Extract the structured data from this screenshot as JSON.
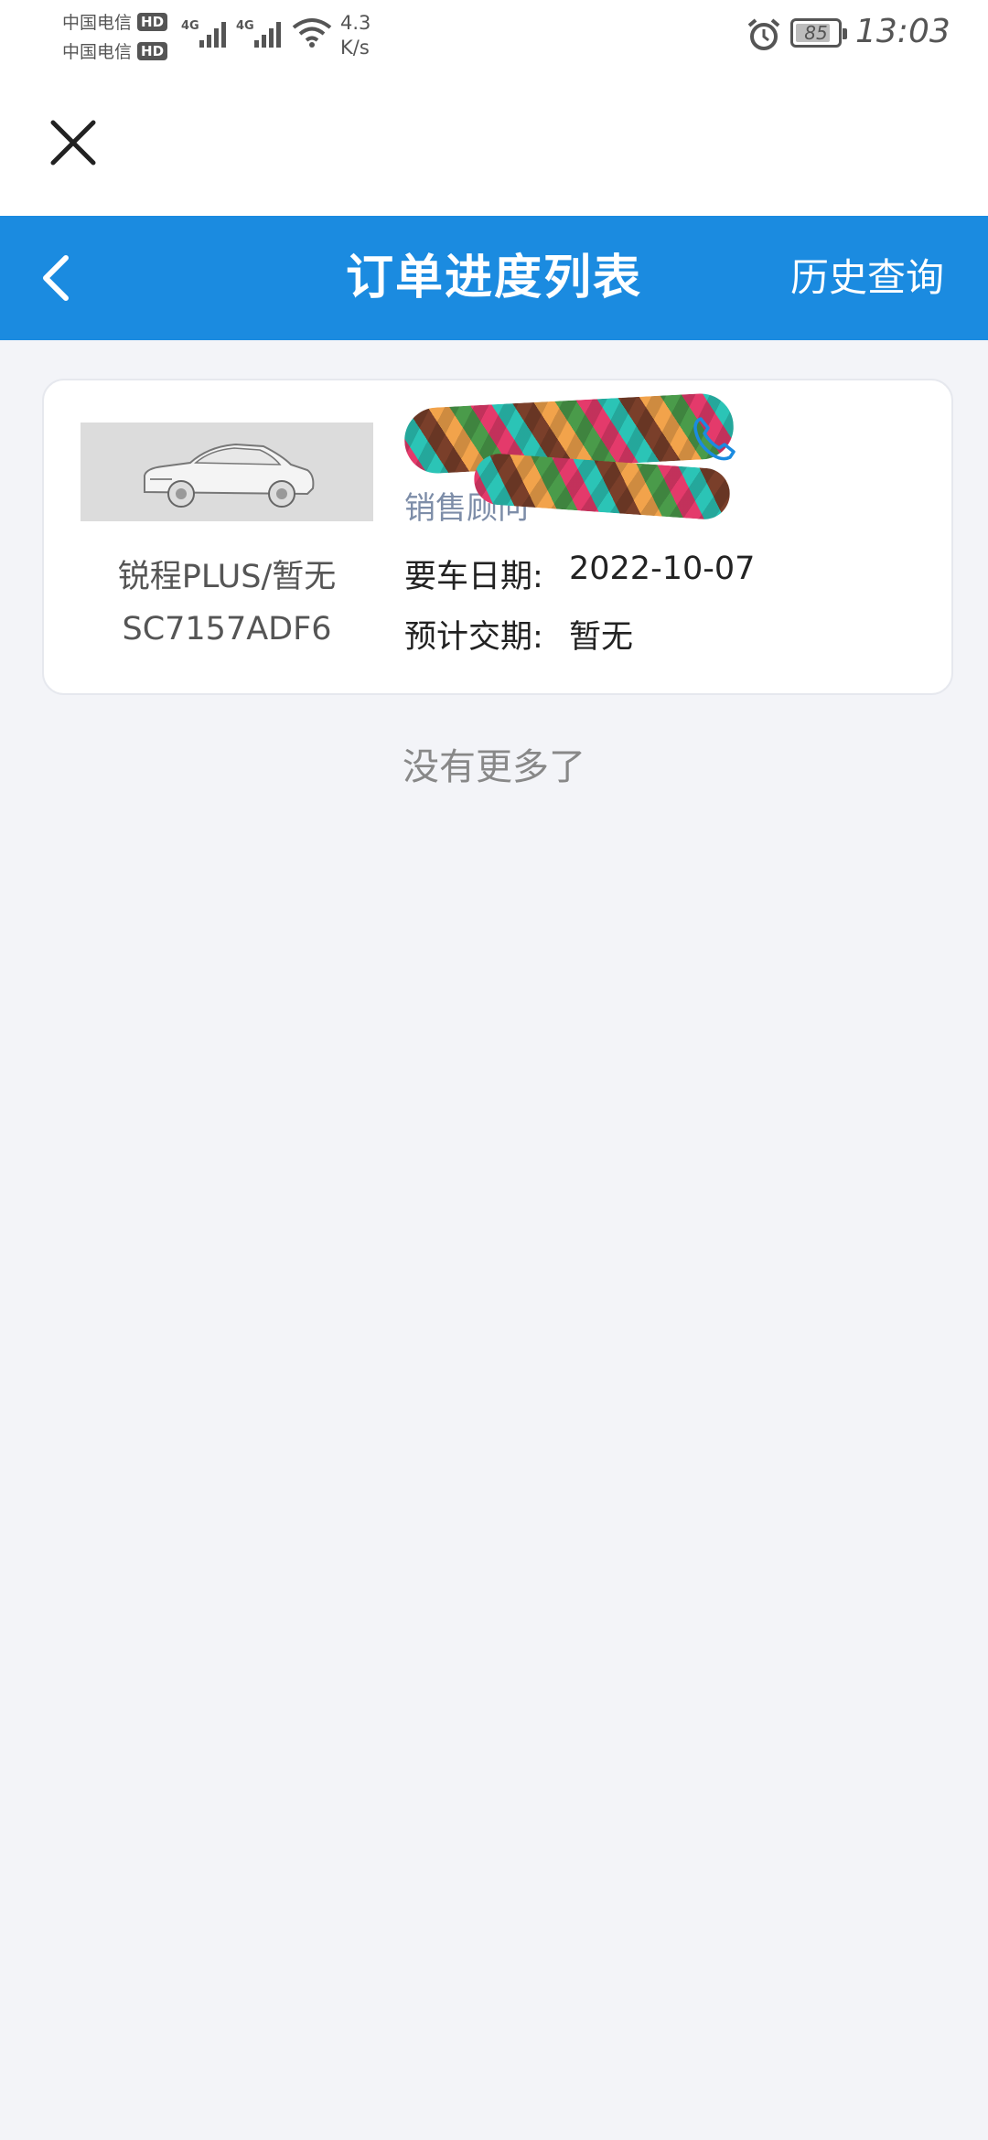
{
  "status_bar": {
    "carrier1": "中国电信",
    "carrier2": "中国电信",
    "hd_badge": "HD",
    "net1": "4G",
    "net2": "4G",
    "net_speed_value": "4.3",
    "net_speed_unit": "K/s",
    "battery": "85",
    "battery_level": 0.85,
    "time": "13:03"
  },
  "nav": {
    "title": "订单进度列表",
    "right_action": "历史查询"
  },
  "orders": [
    {
      "model": "锐程PLUS/暂无",
      "vin": "SC7157ADF6",
      "advisor_label": "销售顾问",
      "pickup_date_label": "要车日期:",
      "pickup_date": "2022-10-07",
      "delivery_label": "预计交期:",
      "delivery": "暂无"
    }
  ],
  "list_footer": "没有更多了",
  "colors": {
    "primary": "#1b8be0",
    "background": "#f3f4f8",
    "advisor_label": "#7d8da8",
    "phone_icon": "#1b8be0"
  }
}
